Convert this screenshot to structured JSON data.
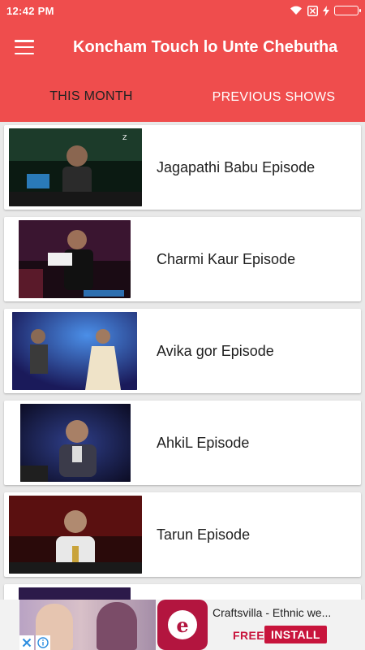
{
  "status_bar": {
    "time": "12:42 PM",
    "icons": [
      "wifi-icon",
      "sim-disabled-icon",
      "charging-icon",
      "battery-icon"
    ],
    "battery_level": 1.0
  },
  "toolbar": {
    "menu_icon": "hamburger-menu-icon",
    "title": "Koncham Touch lo Unte Chebutha"
  },
  "tabs": [
    {
      "label": "THIS MONTH",
      "active": true
    },
    {
      "label": "PREVIOUS SHOWS",
      "active": false
    }
  ],
  "episodes": [
    {
      "title": "Jagapathi Babu Episode"
    },
    {
      "title": "Charmi Kaur Episode"
    },
    {
      "title": "Avika gor Episode"
    },
    {
      "title": "AhkiL Episode"
    },
    {
      "title": "Tarun Episode"
    },
    {
      "title": ""
    }
  ],
  "ad": {
    "text": "Craftsvilla - Ethnic we...",
    "free_label": "FREE",
    "install_label": "INSTALL",
    "logo_letter": "e",
    "close_icon": "close-icon",
    "info_icon": "info-icon"
  },
  "colors": {
    "primary": "#ef4d4d",
    "ad_accent": "#c8143c"
  }
}
